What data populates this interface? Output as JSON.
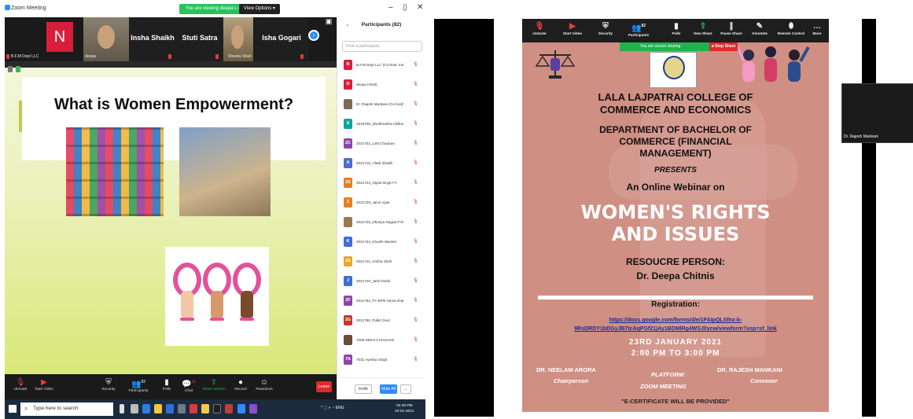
{
  "left": {
    "titlebar": {
      "app": "Zoom Meeting",
      "sharing": "You are viewing deepa's screen",
      "view_options": "View Options ▾",
      "min": "–",
      "max": "▯",
      "close": "✕"
    },
    "tiles": [
      {
        "type": "initial",
        "initial": "N",
        "caption": "B.F.M Dept LLC"
      },
      {
        "type": "video",
        "caption": "deepa"
      },
      {
        "type": "name",
        "name": "Insha Shaikh"
      },
      {
        "type": "name",
        "name": "Stuti Satra"
      },
      {
        "type": "video",
        "caption": "Shweta Shah"
      },
      {
        "type": "name",
        "name": "Isha Gogari"
      }
    ],
    "slide": {
      "title": "What is Women Empowerment?"
    },
    "panel": {
      "title": "Participants (82)",
      "search_placeholder": "Find a participant",
      "participants": [
        {
          "initial": "N",
          "name": "B.F.M Dept LLC (Co-host, me)",
          "color": "#d81e3b"
        },
        {
          "initial": "D",
          "name": "deepa (Host)",
          "color": "#d81e3b"
        },
        {
          "initial": "",
          "name": "Dr. Rajesh Mankani (Co-host)",
          "color": "#7b6a5a"
        },
        {
          "initial": "S",
          "name": "1819708_Shubhrasha Chilkoori",
          "color": "#14a39a"
        },
        {
          "initial": "2C",
          "name": "2021702_Lalit Chauhan",
          "color": "#8e44ad"
        },
        {
          "initial": "A",
          "name": "2021718_Aftab Shaikh",
          "color": "#4a6fd1"
        },
        {
          "initial": "2S",
          "name": "2021723_Niyati Singh FY",
          "color": "#e67e22"
        },
        {
          "initial": "2",
          "name": "2021729_Janvi Vyas",
          "color": "#e67e22"
        },
        {
          "initial": "",
          "name": "2021728_Dhairya Nagda FYBFM",
          "color": "#9b7653"
        },
        {
          "initial": "K",
          "name": "2021734_Khushi Wanker",
          "color": "#3e6ed6"
        },
        {
          "initial": "2S",
          "name": "2021742_Krisha Shah",
          "color": "#e6a72a"
        },
        {
          "initial": "J",
          "name": "2021749_Jash Doshi",
          "color": "#3e6ed6"
        },
        {
          "initial": "2F",
          "name": "2021752_FY BFM Huma shaikh",
          "color": "#8e44ad"
        },
        {
          "initial": "2G",
          "name": "2021766_Pulkit Goel",
          "color": "#c0392b"
        },
        {
          "initial": "",
          "name": "7005 NIDHI CHAUHAN",
          "color": "#6b4a3a"
        },
        {
          "initial": "7A",
          "name": "7031 Ayesha Singh",
          "color": "#8e44ad"
        }
      ],
      "invite": "Invite",
      "mute_all": "Mute All",
      "more": "..."
    },
    "toolbar": {
      "unmute": "Unmute",
      "start_video": "Start Video",
      "security": "Security",
      "participants": "Participants",
      "participants_count": "82",
      "polls": "Polls",
      "chat": "Chat",
      "chat_badge": "11",
      "share_screen": "Share Screen",
      "record": "Record",
      "reactions": "Reactions",
      "leave": "Leave"
    },
    "taskbar": {
      "search": "Type here to search",
      "tray": "^ ⬚ ◐ ◔ ENG",
      "time": "02:48 PM",
      "date": "23-01-2021"
    }
  },
  "right": {
    "toolbar": {
      "unmute": "Unmute",
      "start_video": "Start Video",
      "security": "Security",
      "participants": "Participants",
      "participants_count": "82",
      "polls": "Polls",
      "new_share": "New Share",
      "pause_share": "Pause Share",
      "annotate": "Annotate",
      "remote_control": "Remote Control",
      "more": "More"
    },
    "sharebar": "You are screen sharing",
    "stop_share": "■ Stop Share",
    "flyer": {
      "college1": "LALA LAJPATRAI COLLEGE OF",
      "college2": "COMMERCE AND ECONOMICS",
      "dept1": "DEPARTMENT OF BACHELOR OF",
      "dept2": "COMMERCE (FINANCIAL",
      "dept3": "MANAGEMENT)",
      "presents": "PRESENTS",
      "online": "An Online Webinar on",
      "topic1": "WOMEN'S RIGHTS",
      "topic2": "AND ISSUES",
      "resource": "RESOUCRE PERSON:",
      "person": "Dr. Deepa Chitnis",
      "registration": "Registration:",
      "link1": "https://docs.google.com/forms/d/e/1FAIpQLSfnz-b-",
      "link2": "9RsDRDY1bDGyJB7tcAqPGf21jAy1BDMlRg4WSJ0ycw/viewform?usp=sf_link",
      "date": "23RD JANUARY 2021",
      "time": "2:00 PM TO 3:00 PM",
      "chair_name": "DR. NEELAM ARORA",
      "chair_role": "Chairperson",
      "platform": "PLATFORM:",
      "platform_val": "ZOOM MEETING",
      "conv_name": "DR. RAJESH MANKANI",
      "conv_role": "Convener",
      "cert": "\"E-CERTIFICATE WILL BE PROVIDED\""
    },
    "thumb_name": "Dr. Rajesh Mankani"
  }
}
